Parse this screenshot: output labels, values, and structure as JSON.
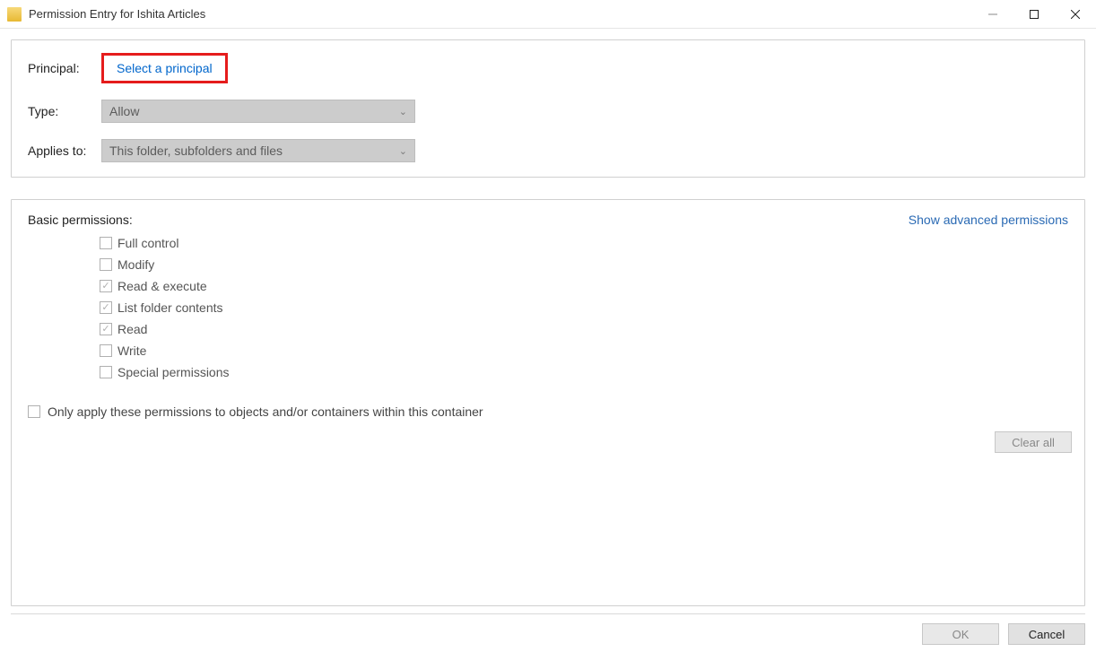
{
  "window": {
    "title": "Permission Entry for Ishita Articles"
  },
  "top": {
    "principal_label": "Principal:",
    "principal_link": "Select a principal",
    "type_label": "Type:",
    "type_value": "Allow",
    "applies_label": "Applies to:",
    "applies_value": "This folder, subfolders and files"
  },
  "basic": {
    "title": "Basic permissions:",
    "advanced_link": "Show advanced permissions",
    "perms": [
      {
        "label": "Full control",
        "checked": false
      },
      {
        "label": "Modify",
        "checked": false
      },
      {
        "label": "Read & execute",
        "checked": true
      },
      {
        "label": "List folder contents",
        "checked": true
      },
      {
        "label": "Read",
        "checked": true
      },
      {
        "label": "Write",
        "checked": false
      },
      {
        "label": "Special permissions",
        "checked": false
      }
    ],
    "only_apply": "Only apply these permissions to objects and/or containers within this container",
    "clear_all": "Clear all"
  },
  "footer": {
    "ok": "OK",
    "cancel": "Cancel"
  }
}
